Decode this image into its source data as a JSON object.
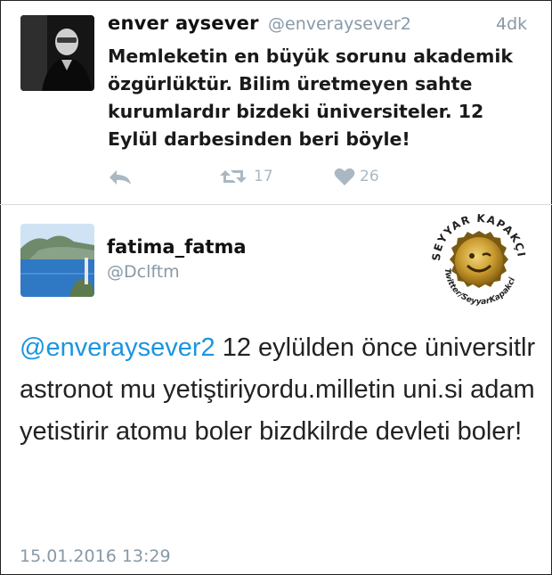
{
  "tweet1": {
    "author_name": "enver aysever",
    "handle": "@enveraysever2",
    "time": "4dk",
    "text": "Memleketin en büyük sorunu akademik özgürlüktür. Bilim üretmeyen sahte kurumlardır bizdeki üniversiteler. 12 Eylül darbesinden beri böyle!",
    "retweet_count": "17",
    "like_count": "26",
    "icons": [
      "reply-icon",
      "retweet-icon",
      "heart-icon"
    ]
  },
  "tweet2": {
    "author_name": "fatima_fatma",
    "handle": "@Dclftm",
    "mention": "@enveraysever2",
    "text": " 12 eylülden önce üniversitlr astronot mu yetiştiriyordu.milletin uni.si adam yetistirir atomu boler bizdkilrde devleti boler!",
    "date": "15.01.2016 13:29"
  },
  "watermark": {
    "top_text": "SEYYAR KAPAKÇI",
    "bottom_text": "Twitter/SeyyarKapakci"
  },
  "colors": {
    "link": "#1b95e0",
    "muted": "#8899a6",
    "icon": "#aab8c2"
  }
}
